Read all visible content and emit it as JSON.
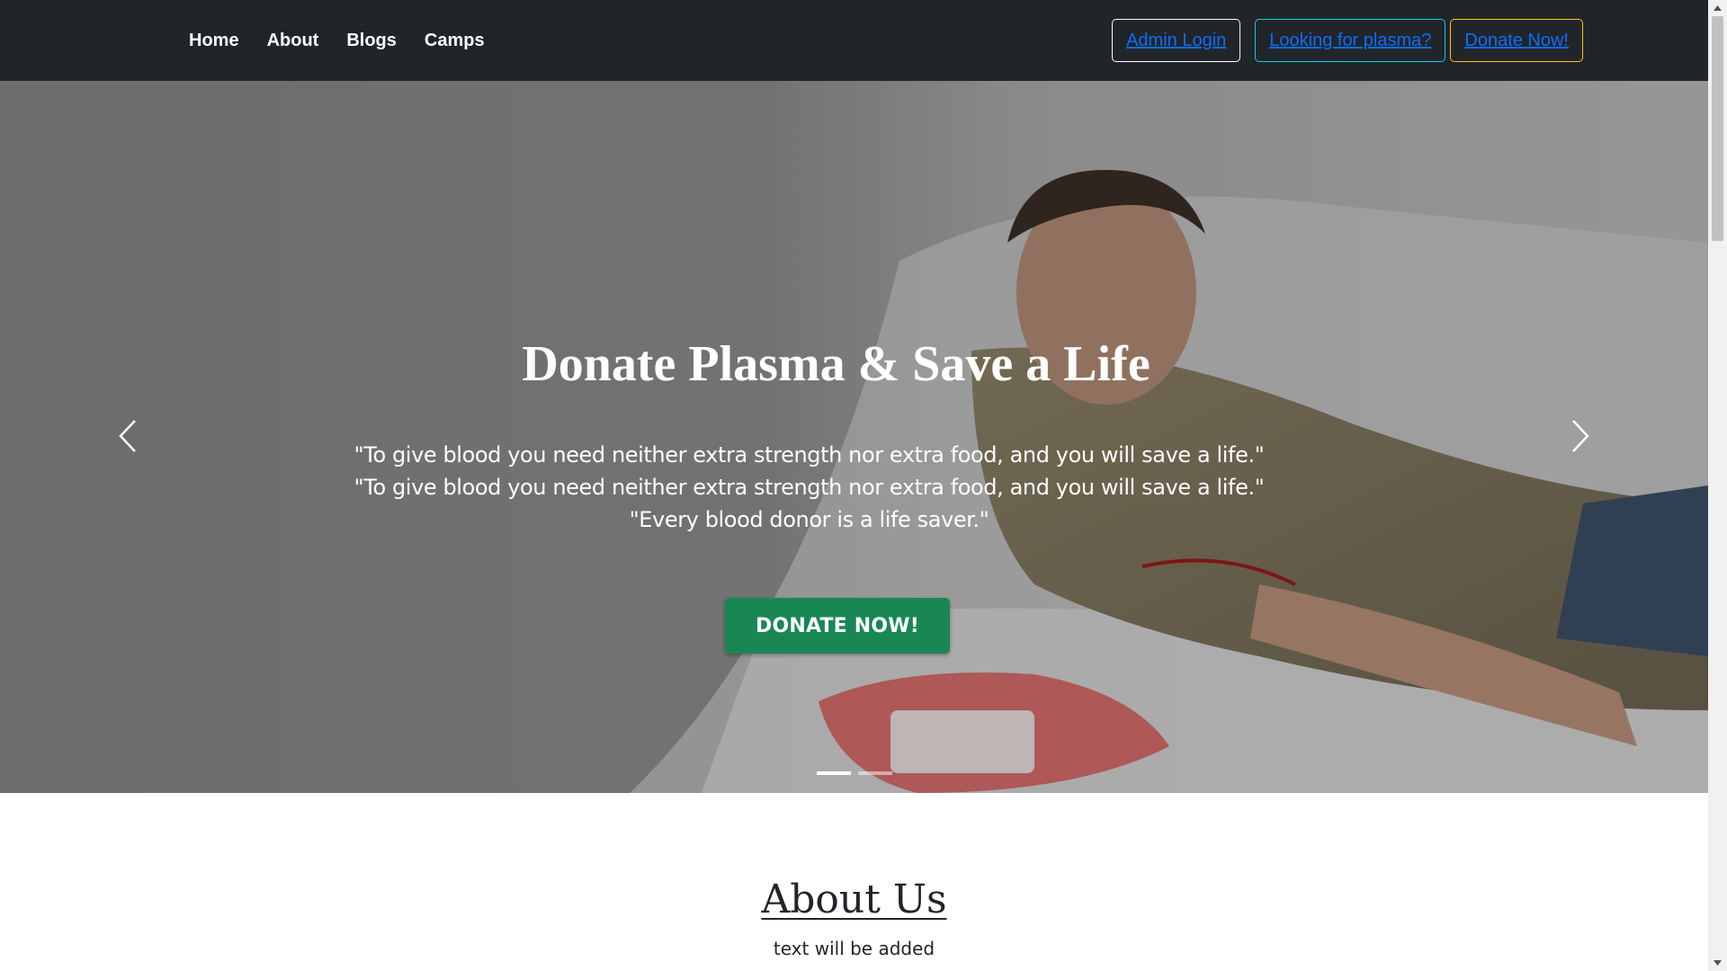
{
  "nav": {
    "links": [
      "Home",
      "About",
      "Blogs",
      "Camps"
    ],
    "admin_login": "Admin Login",
    "looking_for_plasma": "Looking for plasma?",
    "donate_now": "Donate Now!"
  },
  "hero": {
    "title": "Donate Plasma & Save a Life",
    "quotes": [
      "\"To give blood you need neither extra strength nor extra food, and you will save a life.\"",
      "\"To give blood you need neither extra strength nor extra food, and you will save a life.\"",
      "\"Every blood donor is a life saver.\""
    ],
    "cta_label": "DONATE NOW!",
    "slide_count": 2,
    "active_slide": 1
  },
  "about": {
    "title": "About Us",
    "text": "text will be added"
  },
  "colors": {
    "navbar_bg": "#212529",
    "cta_green": "#198754",
    "link_blue": "#0d6efd",
    "info_border": "#0dcaf0",
    "warning_border": "#ffc107"
  },
  "icons": {
    "prev": "chevron-left-icon",
    "next": "chevron-right-icon"
  }
}
